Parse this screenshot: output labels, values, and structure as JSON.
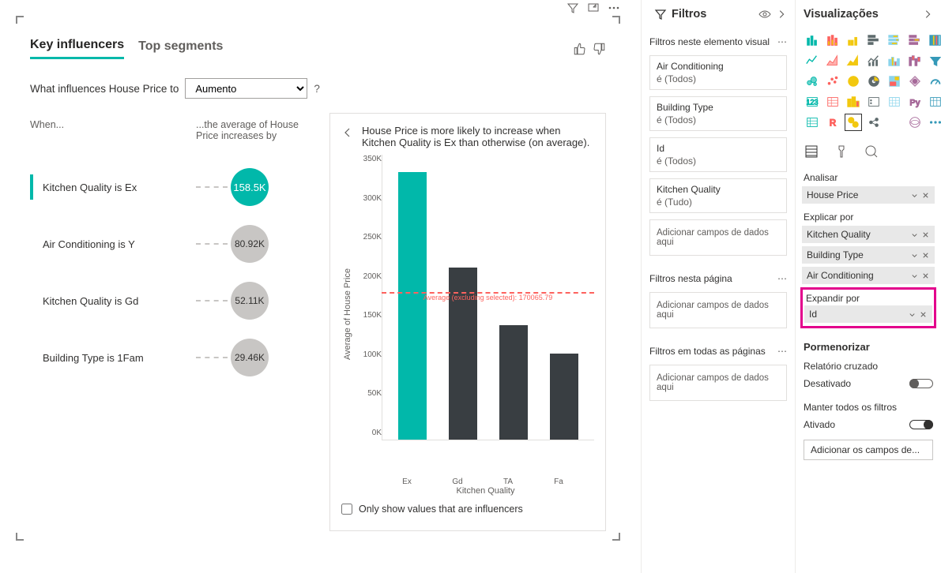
{
  "visual": {
    "tabs": [
      "Key influencers",
      "Top segments"
    ],
    "activeTab": 0,
    "question_prefix": "What influences House Price to",
    "question_select": "Aumento",
    "question_mark": "?",
    "headers": {
      "when": "When...",
      "avg": "...the average of House Price increases by"
    },
    "influencers": [
      {
        "label": "Kitchen Quality is Ex",
        "value": "158.5K",
        "size": 48,
        "selected": true
      },
      {
        "label": "Air Conditioning is Y",
        "value": "80.92K",
        "size": 48,
        "selected": false
      },
      {
        "label": "Kitchen Quality is Gd",
        "value": "52.11K",
        "size": 48,
        "selected": false
      },
      {
        "label": "Building Type is 1Fam",
        "value": "29.46K",
        "size": 48,
        "selected": false
      }
    ],
    "chart": {
      "title": "House Price is more likely to increase when Kitchen Quality is Ex than otherwise (on average).",
      "ylabel": "Average of House Price",
      "xlabel": "Kitchen Quality",
      "only_influencers_label": "Only show values that are influencers",
      "refline_label": "Average (excluding selected): 170065.79"
    }
  },
  "filters": {
    "title": "Filtros",
    "sections": [
      {
        "title": "Filtros neste elemento visual",
        "cards": [
          {
            "name": "Air Conditioning",
            "value": "é (Todos)"
          },
          {
            "name": "Building Type",
            "value": "é (Todos)"
          },
          {
            "name": "Id",
            "value": "é (Todos)"
          },
          {
            "name": "Kitchen Quality",
            "value": "é (Tudo)"
          }
        ],
        "placeholder": "Adicionar campos de dados aqui"
      },
      {
        "title": "Filtros nesta página",
        "placeholder": "Adicionar campos de dados aqui"
      },
      {
        "title": "Filtros em todas as páginas",
        "placeholder": "Adicionar campos de dados aqui"
      }
    ]
  },
  "viz": {
    "title": "Visualizações",
    "wells": {
      "analisar": {
        "label": "Analisar",
        "items": [
          "House Price"
        ]
      },
      "explicar": {
        "label": "Explicar por",
        "items": [
          "Kitchen Quality",
          "Building Type",
          "Air Conditioning"
        ]
      },
      "expandir": {
        "label": "Expandir por",
        "items": [
          "Id"
        ]
      }
    },
    "drill": {
      "header": "Pormenorizar",
      "cross": "Relatório cruzado",
      "cross_state": "Desativado",
      "keep": "Manter todos os filtros",
      "keep_state": "Ativado",
      "add": "Adicionar os campos de..."
    }
  },
  "chart_data": {
    "type": "bar",
    "categories": [
      "Ex",
      "Gd",
      "TA",
      "Fa"
    ],
    "values": [
      328000,
      211000,
      140000,
      105000
    ],
    "selected_index": 0,
    "title": "House Price is more likely to increase when Kitchen Quality is Ex than otherwise (on average).",
    "xlabel": "Kitchen Quality",
    "ylabel": "Average of House Price",
    "ylim": [
      0,
      350000
    ],
    "yticks": [
      "350K",
      "300K",
      "250K",
      "200K",
      "150K",
      "100K",
      "50K",
      "0K"
    ],
    "reference_line": {
      "value": 170065.79,
      "label": "Average (excluding selected): 170065.79"
    }
  }
}
